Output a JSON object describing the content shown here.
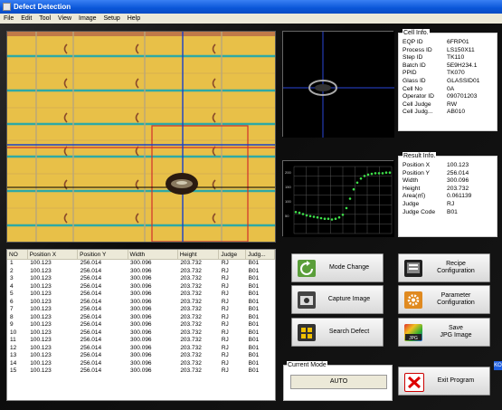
{
  "window": {
    "title": "Defect Detection"
  },
  "menu": [
    "File",
    "Edit",
    "Tool",
    "View",
    "Image",
    "Setup",
    "Help"
  ],
  "cell_info": {
    "legend": "Cell Info.",
    "rows": [
      {
        "k": "EQP ID",
        "v": "6FRP01"
      },
      {
        "k": "Process ID",
        "v": "LS150X11"
      },
      {
        "k": "Step ID",
        "v": "TK110"
      },
      {
        "k": "Batch ID",
        "v": "5E9H234.1"
      },
      {
        "k": "PPID",
        "v": "TK070"
      },
      {
        "k": "Glass ID",
        "v": "GLASSID01"
      },
      {
        "k": "Cell No",
        "v": "0A"
      },
      {
        "k": "Operator ID",
        "v": "090701203"
      },
      {
        "k": "Cell Judge",
        "v": "RW"
      },
      {
        "k": "Cell Judg...",
        "v": "AB010"
      }
    ]
  },
  "result_info": {
    "legend": "Result Info.",
    "rows": [
      {
        "k": "Position X",
        "v": "100.123"
      },
      {
        "k": "Position Y",
        "v": "256.014"
      },
      {
        "k": "Width",
        "v": "300.096"
      },
      {
        "k": "Height",
        "v": "203.732"
      },
      {
        "k": "Area(㎡)",
        "v": "0.061139"
      },
      {
        "k": "Judge",
        "v": "RJ"
      },
      {
        "k": "Judge Code",
        "v": "B01"
      }
    ]
  },
  "table": {
    "headers": [
      "NO",
      "Position X",
      "Position Y",
      "Width",
      "Height",
      "Judge",
      "Judg..."
    ],
    "rows": [
      [
        "1",
        "100.123",
        "256.014",
        "300.096",
        "203.732",
        "RJ",
        "B01"
      ],
      [
        "2",
        "100.123",
        "256.014",
        "300.096",
        "203.732",
        "RJ",
        "B01"
      ],
      [
        "3",
        "100.123",
        "256.014",
        "300.096",
        "203.732",
        "RJ",
        "B01"
      ],
      [
        "4",
        "100.123",
        "256.014",
        "300.096",
        "203.732",
        "RJ",
        "B01"
      ],
      [
        "5",
        "100.123",
        "256.014",
        "300.096",
        "203.732",
        "RJ",
        "B01"
      ],
      [
        "6",
        "100.123",
        "256.014",
        "300.096",
        "203.732",
        "RJ",
        "B01"
      ],
      [
        "7",
        "100.123",
        "256.014",
        "300.096",
        "203.732",
        "RJ",
        "B01"
      ],
      [
        "8",
        "100.123",
        "256.014",
        "300.096",
        "203.732",
        "RJ",
        "B01"
      ],
      [
        "9",
        "100.123",
        "256.014",
        "300.096",
        "203.732",
        "RJ",
        "B01"
      ],
      [
        "10",
        "100.123",
        "256.014",
        "300.096",
        "203.732",
        "RJ",
        "B01"
      ],
      [
        "11",
        "100.123",
        "256.014",
        "300.096",
        "203.732",
        "RJ",
        "B01"
      ],
      [
        "12",
        "100.123",
        "256.014",
        "300.096",
        "203.732",
        "RJ",
        "B01"
      ],
      [
        "13",
        "100.123",
        "256.014",
        "300.096",
        "203.732",
        "RJ",
        "B01"
      ],
      [
        "14",
        "100.123",
        "256.014",
        "300.096",
        "203.732",
        "RJ",
        "B01"
      ],
      [
        "15",
        "100.123",
        "256.014",
        "300.096",
        "203.732",
        "RJ",
        "B01"
      ]
    ]
  },
  "graph": {
    "y_ticks": [
      "200",
      "150",
      "100",
      "50"
    ],
    "values": [
      0.32,
      0.31,
      0.29,
      0.27,
      0.26,
      0.25,
      0.24,
      0.23,
      0.22,
      0.22,
      0.21,
      0.22,
      0.24,
      0.28,
      0.38,
      0.52,
      0.66,
      0.76,
      0.82,
      0.86,
      0.88,
      0.89,
      0.9,
      0.9,
      0.9,
      0.91,
      0.91
    ]
  },
  "buttons": {
    "mode_change": "Mode Change",
    "recipe": "Recipe\nConfiguration",
    "capture": "Capture Image",
    "parameter": "Parameter\nConfiguration",
    "search": "Search Defect",
    "save_jpg": "Save\nJPG Image",
    "exit": "Exit Program",
    "jpg_icon_text": "JPG"
  },
  "current_mode": {
    "legend": "Current Mode",
    "value": "AUTO"
  },
  "tray_label": "KO",
  "colors": {
    "title_bar": "#0a56d8",
    "panel_bg": "#e9c34a",
    "stripe": "#3aa8a0",
    "marker_red": "#c0392b",
    "crosshair": "#1a3fc8",
    "graph_points": "#3ee04a"
  }
}
